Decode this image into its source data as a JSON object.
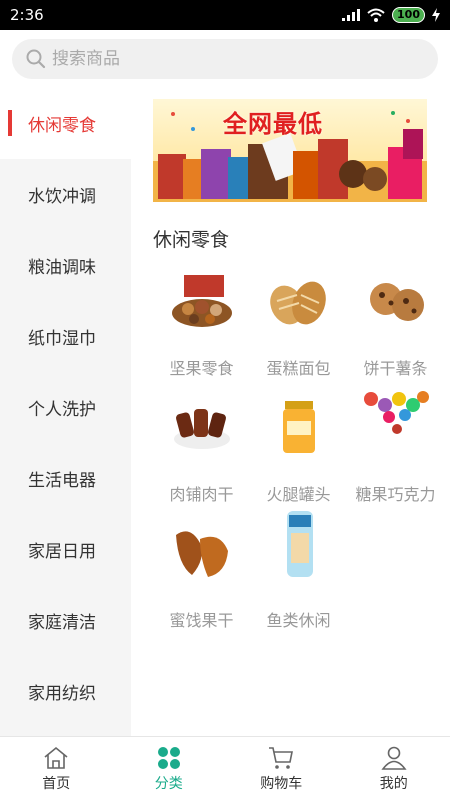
{
  "statusbar": {
    "time": "2:36",
    "battery": "100"
  },
  "search": {
    "placeholder": "搜索商品"
  },
  "sidebar": {
    "items": [
      {
        "label": "休闲零食"
      },
      {
        "label": "水饮冲调"
      },
      {
        "label": "粮油调味"
      },
      {
        "label": "纸巾湿巾"
      },
      {
        "label": "个人洗护"
      },
      {
        "label": "生活电器"
      },
      {
        "label": "家居日用"
      },
      {
        "label": "家庭清洁"
      },
      {
        "label": "家用纺织"
      }
    ]
  },
  "banner": {
    "title": "全网最低"
  },
  "section": {
    "title": "休闲零食",
    "items": [
      {
        "label": "坚果零食",
        "icon": "nuts-image"
      },
      {
        "label": "蛋糕面包",
        "icon": "bread-image"
      },
      {
        "label": "饼干薯条",
        "icon": "cookies-image"
      },
      {
        "label": "肉铺肉干",
        "icon": "jerky-image"
      },
      {
        "label": "火腿罐头",
        "icon": "canned-fruit-image"
      },
      {
        "label": "糖果巧克力",
        "icon": "candy-image"
      },
      {
        "label": "蜜饯果干",
        "icon": "dried-fruit-image"
      },
      {
        "label": "鱼类休闲",
        "icon": "fish-snack-image"
      }
    ]
  },
  "tabbar": {
    "tabs": [
      {
        "label": "首页",
        "icon": "home-icon"
      },
      {
        "label": "分类",
        "icon": "category-icon"
      },
      {
        "label": "购物车",
        "icon": "cart-icon"
      },
      {
        "label": "我的",
        "icon": "user-icon"
      }
    ]
  },
  "colors": {
    "accent": "#1aab8b",
    "active_red": "#e53935",
    "sidebar_bg": "#f5f5f5"
  }
}
